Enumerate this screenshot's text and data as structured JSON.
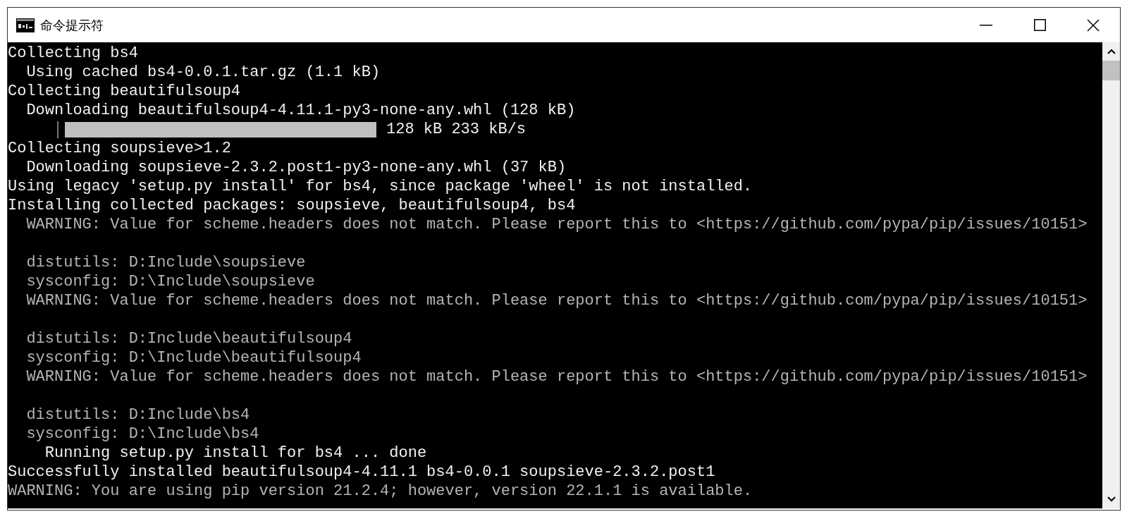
{
  "window": {
    "title": "命令提示符"
  },
  "console": {
    "lines": [
      {
        "kind": "text",
        "dim": false,
        "text": "Collecting bs4"
      },
      {
        "kind": "text",
        "dim": false,
        "text": "  Using cached bs4-0.0.1.tar.gz (1.1 kB)"
      },
      {
        "kind": "text",
        "dim": false,
        "text": "Collecting beautifulsoup4"
      },
      {
        "kind": "text",
        "dim": false,
        "text": "  Downloading beautifulsoup4-4.11.1-py3-none-any.whl (128 kB)"
      },
      {
        "kind": "progress",
        "dim": false,
        "level": 1,
        "text": "128 kB 233 kB/s"
      },
      {
        "kind": "text",
        "dim": false,
        "text": "Collecting soupsieve>1.2"
      },
      {
        "kind": "text",
        "dim": false,
        "text": "  Downloading soupsieve-2.3.2.post1-py3-none-any.whl (37 kB)"
      },
      {
        "kind": "text",
        "dim": false,
        "text": "Using legacy 'setup.py install' for bs4, since package 'wheel' is not installed."
      },
      {
        "kind": "text",
        "dim": false,
        "text": "Installing collected packages: soupsieve, beautifulsoup4, bs4"
      },
      {
        "kind": "text",
        "dim": true,
        "text": "  WARNING: Value for scheme.headers does not match. Please report this to <https://github.com/pypa/pip/issues/10151>"
      },
      {
        "kind": "blank"
      },
      {
        "kind": "text",
        "dim": true,
        "text": "  distutils: D:Include\\soupsieve"
      },
      {
        "kind": "text",
        "dim": true,
        "text": "  sysconfig: D:\\Include\\soupsieve"
      },
      {
        "kind": "text",
        "dim": true,
        "text": "  WARNING: Value for scheme.headers does not match. Please report this to <https://github.com/pypa/pip/issues/10151>"
      },
      {
        "kind": "blank"
      },
      {
        "kind": "text",
        "dim": true,
        "text": "  distutils: D:Include\\beautifulsoup4"
      },
      {
        "kind": "text",
        "dim": true,
        "text": "  sysconfig: D:\\Include\\beautifulsoup4"
      },
      {
        "kind": "text",
        "dim": true,
        "text": "  WARNING: Value for scheme.headers does not match. Please report this to <https://github.com/pypa/pip/issues/10151>"
      },
      {
        "kind": "blank"
      },
      {
        "kind": "text",
        "dim": true,
        "text": "  distutils: D:Include\\bs4"
      },
      {
        "kind": "text",
        "dim": true,
        "text": "  sysconfig: D:\\Include\\bs4"
      },
      {
        "kind": "text",
        "dim": false,
        "text": "    Running setup.py install for bs4 ... done"
      },
      {
        "kind": "text",
        "dim": false,
        "text": "Successfully installed beautifulsoup4-4.11.1 bs4-0.0.1 soupsieve-2.3.2.post1"
      },
      {
        "kind": "text",
        "dim": true,
        "text": "WARNING: You are using pip version 21.2.4; however, version 22.1.1 is available."
      }
    ]
  }
}
